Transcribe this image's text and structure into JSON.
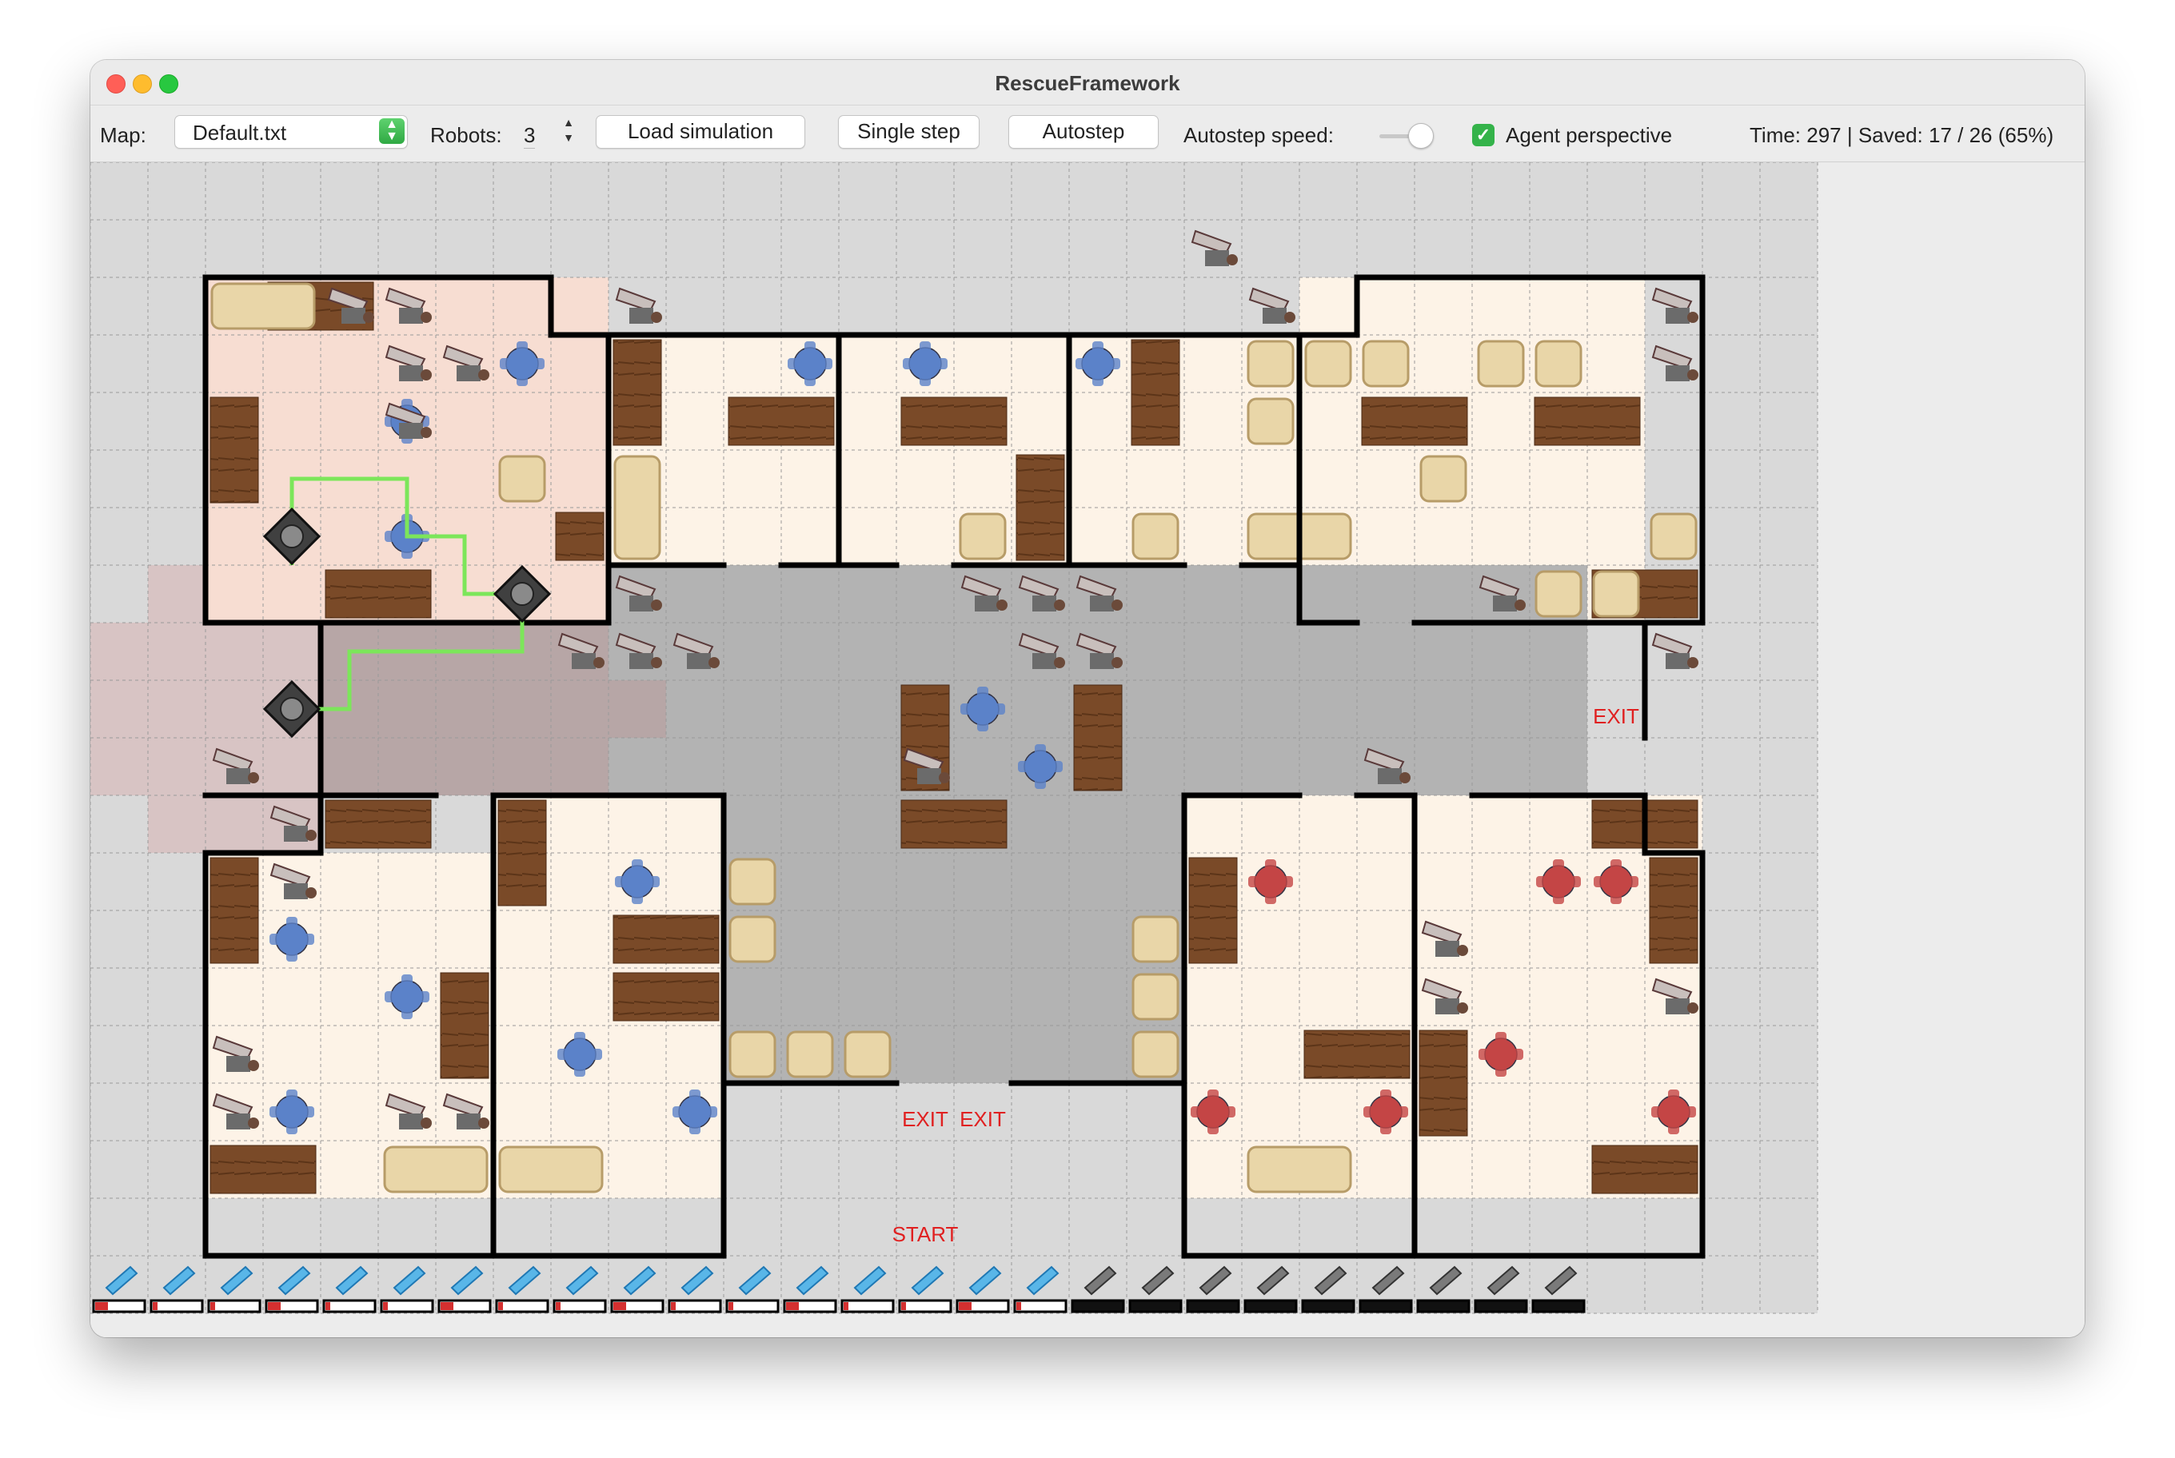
{
  "window": {
    "title": "RescueFramework"
  },
  "toolbar": {
    "map_label": "Map:",
    "map_value": "Default.txt",
    "robots_label": "Robots:",
    "robots_value": "3",
    "load_label": "Load simulation",
    "step_label": "Single step",
    "autostep_label": "Autostep",
    "speed_label": "Autostep speed:",
    "agent_perspective_label": "Agent perspective",
    "agent_perspective_checked": true,
    "status": "Time: 297 | Saved: 17 / 26 (65%)"
  },
  "map": {
    "labels": {
      "exit": "EXIT",
      "start": "START"
    },
    "colors": {
      "floor": "#fdf3e7",
      "corridor": "#b3b3b3",
      "outside": "#d9d9d9",
      "wall": "#000000",
      "seen_room": "#f7ddd2",
      "seen_outside": "#d8c4c4",
      "seen_corridor": "#b7a6a6",
      "path": "#7ce65a",
      "exit_text": "#e02020"
    },
    "injured_total": 26,
    "saved": 17
  }
}
